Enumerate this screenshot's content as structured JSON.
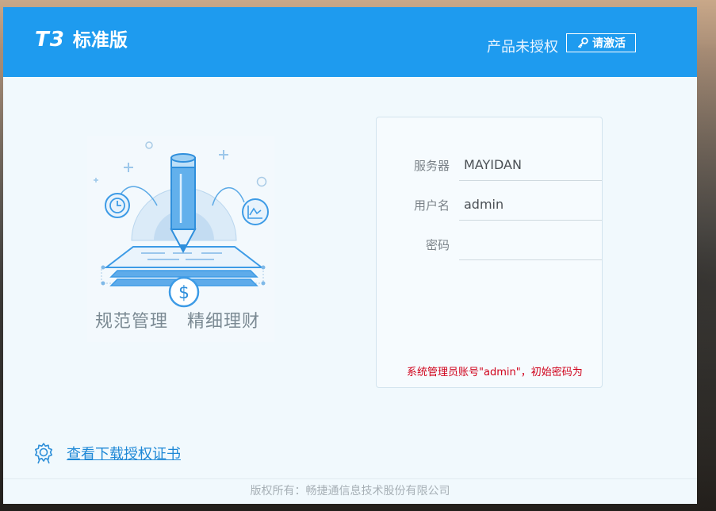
{
  "header": {
    "logo_mark": "T3",
    "logo_text": "标准版",
    "license_status": "产品未授权",
    "activate_label": "请激活"
  },
  "illustration": {
    "slogan_left": "规范管理",
    "slogan_right": "精细理财",
    "currency_symbol": "$"
  },
  "login": {
    "server_label": "服务器",
    "server_value": "MAYIDAN",
    "username_label": "用户名",
    "username_value": "admin",
    "password_label": "密码",
    "password_value": "",
    "hint": "系统管理员账号\"admin\"，初始密码为"
  },
  "cert_link": "查看下载授权证书",
  "footer": "版权所有：畅捷通信息技术股份有限公司",
  "colors": {
    "header_blue": "#1e9bef",
    "panel_bg": "#f1f9fd",
    "hint_red": "#d0021b",
    "link_blue": "#1e88d6"
  },
  "icons": [
    "key-icon",
    "gear-icon",
    "pencil-illustration"
  ]
}
